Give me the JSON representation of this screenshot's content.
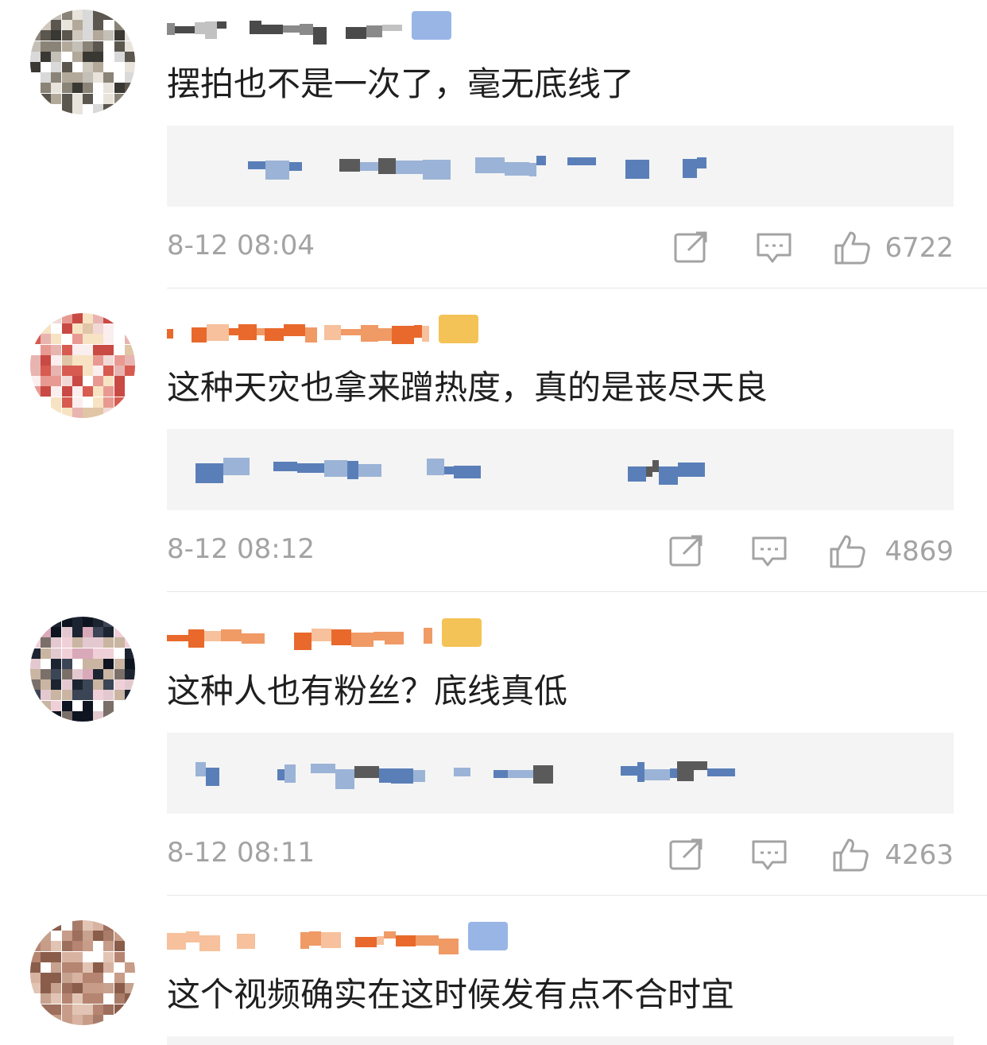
{
  "comments": [
    {
      "text": "摆拍也不是一次了，毫无底线了",
      "time": "8-12 08:04",
      "likes": "6722",
      "avatar_colors": [
        "#d9d9d9",
        "#cfc8bd",
        "#8a8377",
        "#5b564e",
        "#e8e4dc",
        "#b3a99a",
        "#3a3833",
        "#c4c0b8"
      ],
      "name_colors": [
        "#4a4a4a",
        "#8a8a8a",
        "#c2c2c2"
      ],
      "badge_color": "#86a8e0"
    },
    {
      "text": "这种天灾也拿来蹭热度，真的是丧尽天良",
      "time": "8-12 08:12",
      "likes": "4869",
      "avatar_colors": [
        "#f2d9d6",
        "#e89a92",
        "#d75b50",
        "#f7e3c4",
        "#e8b4b0",
        "#c94a44",
        "#fbeeee",
        "#e0c5a6"
      ],
      "name_colors": [
        "#e8692b",
        "#f09a66",
        "#f6c19c"
      ],
      "badge_color": "#f2b93a"
    },
    {
      "text": "这种人也有粉丝？底线真低",
      "time": "8-12 08:11",
      "likes": "4263",
      "avatar_colors": [
        "#1c2431",
        "#3b4556",
        "#c9b5a2",
        "#e3c9cf",
        "#7b6f6a",
        "#d9a9b9",
        "#f0d0d8",
        "#0e1420"
      ],
      "name_colors": [
        "#e8692b",
        "#f09a66",
        "#f6c19c"
      ],
      "badge_color": "#f2b93a"
    },
    {
      "text": "这个视频确实在这时候发有点不合时宜",
      "time": "",
      "likes": "",
      "avatar_colors": [
        "#c79c88",
        "#b58571",
        "#d8b3a2",
        "#9d6f5c",
        "#e2c4b4",
        "#a87c69",
        "#c6a28f",
        "#8a5d4b"
      ],
      "name_colors": [
        "#e8692b",
        "#f09a66",
        "#f6c19c"
      ],
      "badge_color": "#86a8e0"
    }
  ],
  "icons": {
    "share": "share-icon",
    "reply": "reply-icon",
    "like": "thumbs-up-icon"
  },
  "colors": {
    "meta_gray": "#a3a3a3",
    "reply_box_bg": "#f4f4f4",
    "reply_blue": "#5a7fb8"
  }
}
